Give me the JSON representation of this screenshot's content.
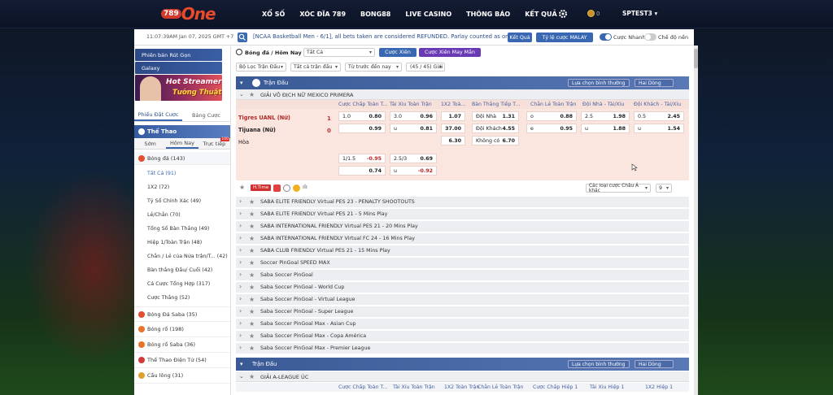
{
  "brand": {
    "logo_num": "789",
    "logo_word": "One"
  },
  "nav": [
    "XỔ SỐ",
    "XÓC ĐĨA 789",
    "BONG88",
    "LIVE CASINO",
    "THÔNG BÁO",
    "KẾT QUẢ"
  ],
  "account": {
    "balance": "0",
    "username": "SPTEST3"
  },
  "infobar": {
    "time": "11:07:39AM Jan 07, 2025 GMT +7",
    "marquee": "[NCAA Basketball Men - 6/1], all bets taken are considered REFUNDED. Parlay counted as one (1).",
    "results_btn": "Kết Quả",
    "odds_type": "Tỷ lệ cược MALAY",
    "quick_bet": "Cược Nhanh",
    "dark_mode": "Chế độ nền"
  },
  "left": {
    "promo1": "Phiên bản Rút Gọn",
    "promo2": "Galaxy",
    "banner_line1": "Hot Streamer",
    "banner_line2": "Tướng Thuật",
    "tab_slip": "Phiếu Đặt Cược",
    "tab_table": "Bảng Cược",
    "sport_header": "Thể Thao",
    "day_tabs": [
      "Sớm",
      "Hôm Nay",
      "Trực tiếp"
    ],
    "live_badge": "100",
    "football": "Bóng đá (143)",
    "sub_items": [
      "Tất Cả (91)",
      "1X2 (72)",
      "Tỷ Số Chính Xác (49)",
      "Lẻ/Chẵn (70)",
      "Tổng Số Bàn Thắng (49)",
      "Hiệp 1/Toàn Trận (48)",
      "Chẵn / Lẻ của Nửa trận/T... (42)",
      "Bàn thắng Đầu/ Cuối (42)",
      "Cá Cược Tổng Hợp (317)",
      "Cược Thắng (52)"
    ],
    "sports": [
      "Bóng Đá Saba (35)",
      "Bóng rổ (198)",
      "Bóng rổ Saba (36)",
      "Thể Thao Điện Tử (54)",
      "Cầu lông (31)"
    ]
  },
  "filters": {
    "breadcrumb": "Bóng đá / Hôm Nay",
    "all": "Tất Cả",
    "parlay": "Cược Xiên",
    "lucky_parlay": "Cược Xiên May Mắn",
    "league_filter": "Bộ Lọc Trận Đấu",
    "all_matches": "Tất cả trận đấu",
    "sort": "Từ trước đến nay",
    "count": "(45 / 45) Giải"
  },
  "section1": {
    "title": "Trận Đấu",
    "sort": "Lựa chọn bình thường",
    "lines": "Hai Dòng"
  },
  "league1": "GIẢI VÔ ĐỊCH NỮ MEXICO PRIMERA",
  "columns1": [
    "Cược Chấp Toàn T...",
    "Tài Xỉu Toàn Trận",
    "1X2 Toà...",
    "Bàn Thắng Tiếp T...",
    "Chẵn Lẻ Toàn Trận",
    "Đội Nhà - Tài/Xỉu",
    "Đội Khách - Tài/Xỉu"
  ],
  "match": {
    "home": "Tigres UANL (Nữ)",
    "away": "Tijuana (Nữ)",
    "draw": "Hòa",
    "home_score": "1",
    "away_score": "0",
    "hdp1_home_h": "1.0",
    "hdp1_home_v": "0.80",
    "hdp1_away_v": "0.99",
    "ou1_h": "3.0",
    "ou1_o": "0.96",
    "ou1_u_h": "u",
    "ou1_u": "0.81",
    "x12_1": "1.07",
    "x12_2": "37.00",
    "x12_x": "6.30",
    "ng_home_h": "Đội Nhà",
    "ng_home": "1.31",
    "ng_away_h": "Đội Khách",
    "ng_away": "4.55",
    "ng_none_h": "Không có",
    "ng_none": "6.70",
    "oe_o_h": "o",
    "oe_o": "0.88",
    "oe_e_h": "e",
    "oe_e": "0.95",
    "hou_h": "2.5",
    "hou_o": "1.98",
    "hou_u_h": "u",
    "hou_u": "1.88",
    "aou_h": "0.5",
    "aou_o": "2.45",
    "aou_u_h": "u",
    "aou_u": "1.54",
    "hdp2_h": "1/1.5",
    "hdp2_home": "-0.95",
    "hdp2_away": "0.74",
    "ou2_h": "2.5/3",
    "ou2_o": "0.69",
    "ou2_u_h": "u",
    "ou2_u": "-0.92"
  },
  "toolbar2": {
    "htime": "H.Time",
    "other_types": "Các loại cược Châu Á khác",
    "num": "9"
  },
  "leagues": [
    "SABA ELITE FRIENDLY Virtual PES 23 - PENALTY SHOOTOUTS",
    "SABA ELITE FRIENDLY Virtual PES 21 - 5 Mins Play",
    "SABA INTERNATIONAL FRIENDLY Virtual PES 21 - 20 Mins Play",
    "SABA INTERNATIONAL FRIENDLY Virtual FC 24 - 16 Mins Play",
    "SABA CLUB FRIENDLY Virtual PES 21 - 15 Mins Play",
    "Soccer PinGoal SPEED MAX",
    "Saba Soccer PinGoal",
    "Saba Soccer PinGoal - World Cup",
    "Saba Soccer PinGoal - Virtual League",
    "Saba Soccer PinGoal - Super League",
    "Saba Soccer PinGoal Max - Asian Cup",
    "Saba Soccer PinGoal Max - Copa América",
    "Saba Soccer PinGoal Max - Premier League"
  ],
  "section2": {
    "title": "Trận Đấu",
    "sort": "Lựa chọn bình thường",
    "lines": "Hai Dòng"
  },
  "league2": "GIẢI A-LEAGUE ÚC",
  "columns2": [
    "Cược Chấp Toàn T...",
    "Tài Xỉu Toàn Trận",
    "1X2 Toàn Trận",
    "Chẵn Lẻ Toàn Trận",
    "Cược Chấp Hiệp 1",
    "Tài Xỉu Hiệp 1",
    "1X2 Hiệp 1"
  ],
  "colors": {
    "accent": "#3a67b1",
    "header": "#4a6aa8",
    "match_bg": "#fbe6df",
    "negative": "#c02020"
  }
}
